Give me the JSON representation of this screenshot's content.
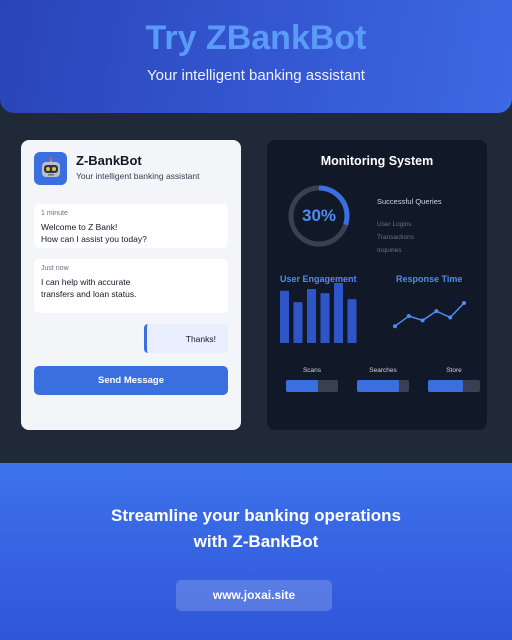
{
  "header": {
    "title": "Try ZBankBot",
    "subtitle": "Your intelligent banking assistant"
  },
  "chat": {
    "bot_name": "Z-BankBot",
    "bot_tagline": "Your intelligent banking assistant",
    "avatar_icon": "robot-icon",
    "messages": [
      {
        "time": "1 minute",
        "text": "Welcome to Z Bank!\nHow can I assist you today?"
      },
      {
        "time": "Just now",
        "text": "I can help with accurate\ntransfers and loan status."
      }
    ],
    "user_reply": "Thanks!",
    "send_label": "Send Message"
  },
  "monitor": {
    "title": "Monitoring System",
    "ring_value": "30%",
    "ring_fraction": 0.3,
    "stat_main": "Successful Queries",
    "stats": [
      "User Logins",
      "Transactions",
      "Inquiries"
    ],
    "engagement_label": "User Engagement",
    "engagement_levels": [
      0.87,
      0.68,
      0.9,
      0.83,
      1.0,
      0.73
    ],
    "response_label": "Response Time",
    "response_points": [
      0.2,
      0.55,
      0.4,
      0.72,
      0.5,
      1.0
    ],
    "progress": [
      {
        "label": "Scans",
        "fraction": 0.62
      },
      {
        "label": "Searches",
        "fraction": 0.81
      },
      {
        "label": "Store",
        "fraction": 0.67
      }
    ]
  },
  "footer": {
    "cta_line1": "Streamline your banking operations",
    "cta_line2": "with Z-BankBot",
    "site": "www.joxai.site"
  },
  "colors": {
    "accent": "#3b6fe0",
    "accent_light": "#4f8cf5",
    "dark_card": "#111827",
    "background": "#1f2937"
  }
}
